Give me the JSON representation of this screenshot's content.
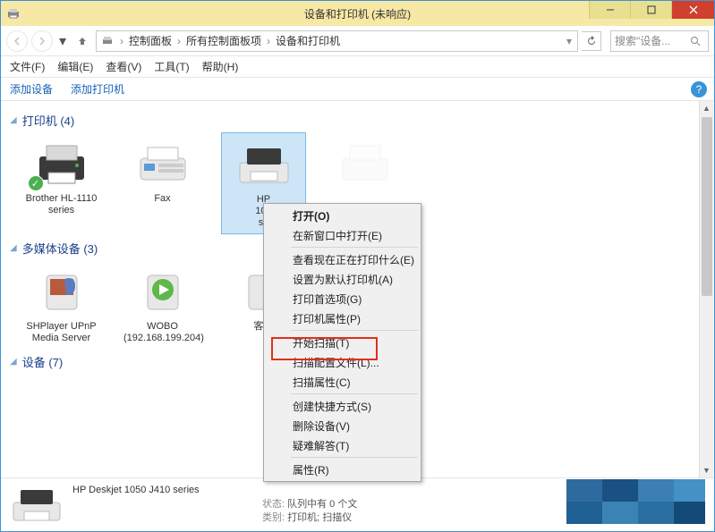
{
  "window": {
    "title": "设备和打印机 (未响应)"
  },
  "nav": {
    "breadcrumb": [
      "控制面板",
      "所有控制面板项",
      "设备和打印机"
    ],
    "search_placeholder": "搜索\"设备..."
  },
  "menubar": {
    "items": [
      "文件(F)",
      "编辑(E)",
      "查看(V)",
      "工具(T)",
      "帮助(H)"
    ]
  },
  "toolbar": {
    "add_device": "添加设备",
    "add_printer": "添加打印机"
  },
  "groups": {
    "printers": {
      "label": "打印机 (4)"
    },
    "media": {
      "label": "多媒体设备 (3)"
    },
    "devices": {
      "label": "设备 (7)"
    }
  },
  "printers": [
    {
      "name": "Brother HL-1110 series",
      "checked": true
    },
    {
      "name": "Fax"
    },
    {
      "name": "HP Deskjet 1050 J410 series",
      "selected": true
    },
    {
      "name": ""
    }
  ],
  "media": [
    {
      "name": "SHPlayer UPnP Media Server"
    },
    {
      "name": "WOBO (192.168.199.204)"
    },
    {
      "name": "客厅"
    }
  ],
  "context_menu": {
    "open": "打开(O)",
    "open_new": "在新窗口中打开(E)",
    "see_printing": "查看现在正在打印什么(E)",
    "set_default": "设置为默认打印机(A)",
    "print_prefs": "打印首选项(G)",
    "printer_props": "打印机属性(P)",
    "start_scan": "开始扫描(T)",
    "scan_profiles": "扫描配置文件(L)...",
    "scan_props": "扫描属性(C)",
    "create_shortcut": "创建快捷方式(S)",
    "remove_device": "删除设备(V)",
    "troubleshoot": "疑难解答(T)",
    "properties": "属性(R)"
  },
  "status": {
    "device_name": "HP Deskjet 1050 J410 series",
    "status_label": "状态:",
    "status_value": "队列中有 0 个文",
    "category_label": "类别:",
    "category_value": "打印机; 扫描仪"
  }
}
